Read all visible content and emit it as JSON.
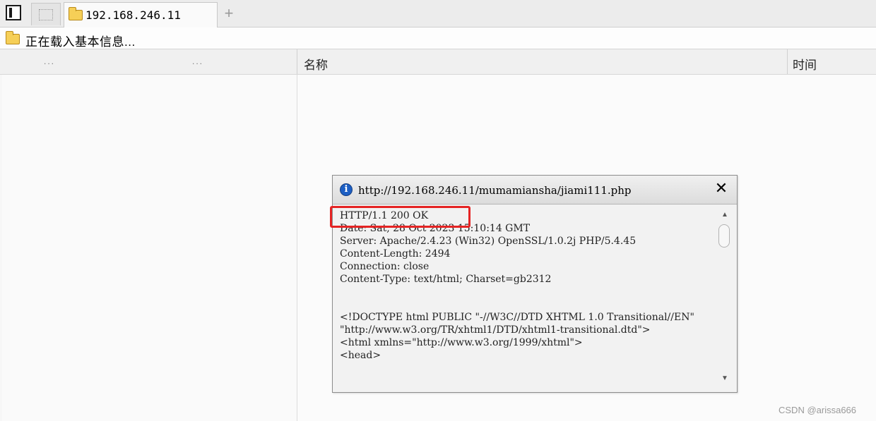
{
  "tabs": {
    "active_label": "192.168.246.11",
    "new_tab_symbol": "+"
  },
  "status": {
    "loading_text": "正在载入基本信息..."
  },
  "columns": {
    "dots_1": "...",
    "dots_2": "...",
    "name_header": "名称",
    "time_header": "时间"
  },
  "popup": {
    "url": "http://192.168.246.11/mumamiansha/jiami111.php",
    "info_symbol": "i",
    "close_symbol": "✕",
    "response_text": "HTTP/1.1 200 OK\nDate: Sat, 28 Oct 2023 15:10:14 GMT\nServer: Apache/2.4.23 (Win32) OpenSSL/1.0.2j PHP/5.4.45\nContent-Length: 2494\nConnection: close\nContent-Type: text/html; Charset=gb2312\n\n\n<!DOCTYPE html PUBLIC \"-//W3C//DTD XHTML 1.0 Transitional//EN\" \"http://www.w3.org/TR/xhtml1/DTD/xhtml1-transitional.dtd\">\n<html xmlns=\"http://www.w3.org/1999/xhtml\">\n<head>",
    "scroll_up_symbol": "▲",
    "scroll_down_symbol": "▼"
  },
  "watermark": "CSDN @arissa666",
  "colors": {
    "highlight": "#e52424",
    "folder": "#f6cf57",
    "info_icon": "#1d5fc4"
  }
}
